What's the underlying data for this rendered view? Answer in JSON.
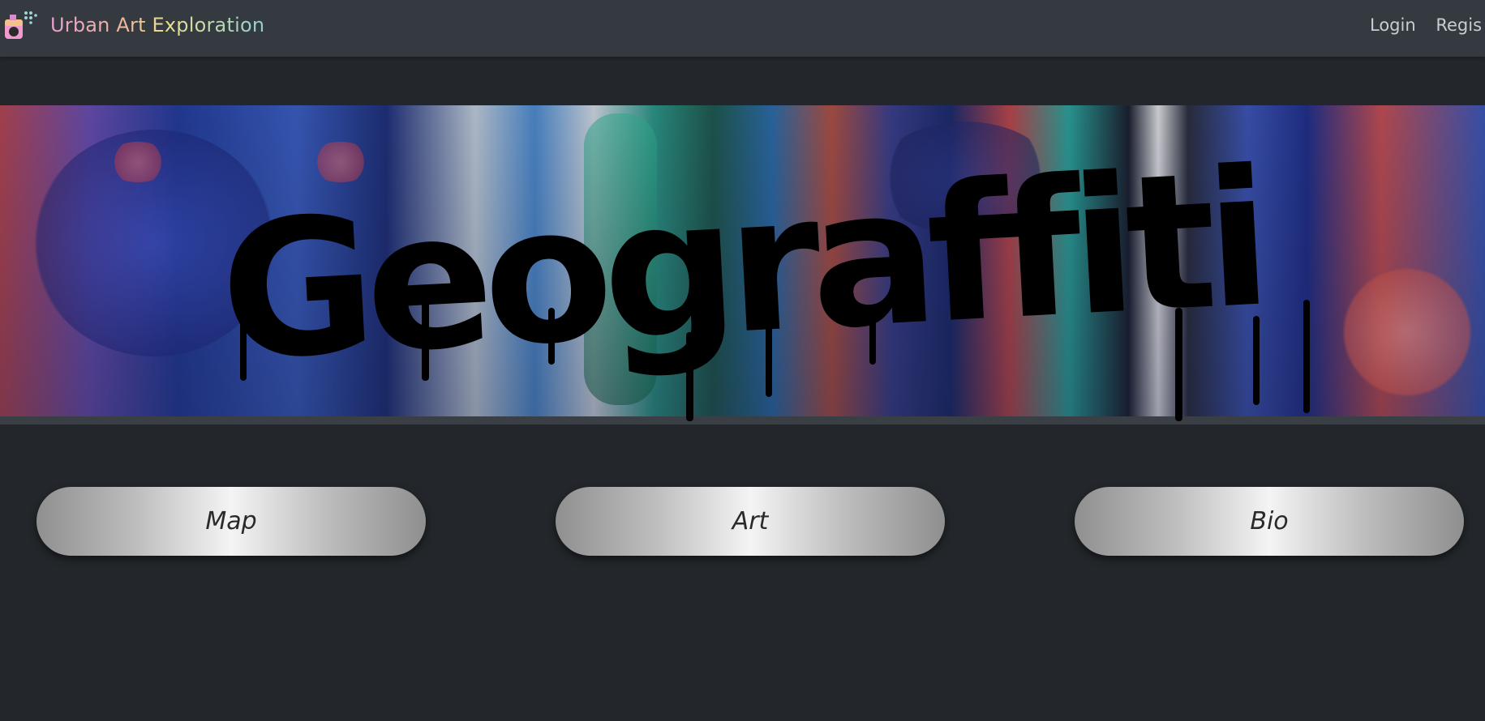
{
  "navbar": {
    "brand": "Urban Art Exploration",
    "logo_icon": "spray-can-icon",
    "links": [
      {
        "label": "Login"
      },
      {
        "label": "Regis"
      }
    ]
  },
  "hero": {
    "title": "Geograffiti"
  },
  "buttons": [
    {
      "label": "Map"
    },
    {
      "label": "Art"
    },
    {
      "label": "Bio"
    }
  ],
  "colors": {
    "page_background": "#23272b",
    "navbar_background": "#343a40",
    "title_color": "#000000"
  }
}
